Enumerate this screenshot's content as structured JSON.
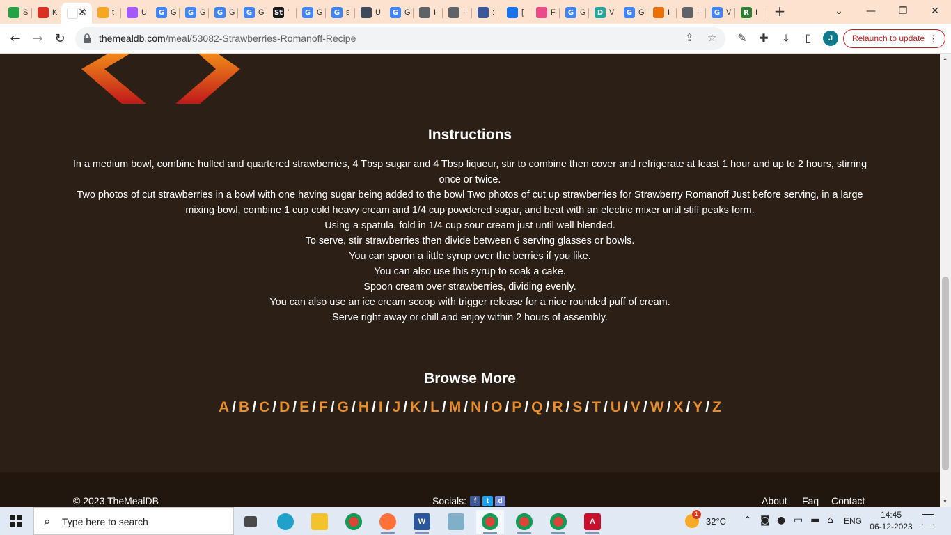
{
  "browser": {
    "tabs": [
      {
        "title": "S",
        "color": "#25a244",
        "glyph": ""
      },
      {
        "title": "K",
        "color": "#d93025",
        "glyph": ""
      },
      {
        "title": "S",
        "color": "#ffffff",
        "glyph": "",
        "active": true
      },
      {
        "title": "t",
        "color": "#f5a623",
        "glyph": ""
      },
      {
        "title": "U",
        "color": "#a259ff",
        "glyph": ""
      },
      {
        "title": "G",
        "color": "#4285f4",
        "glyph": "G"
      },
      {
        "title": "G",
        "color": "#4285f4",
        "glyph": "G"
      },
      {
        "title": "G",
        "color": "#4285f4",
        "glyph": "G"
      },
      {
        "title": "G",
        "color": "#4285f4",
        "glyph": "G"
      },
      {
        "title": "'",
        "color": "#1a1a1a",
        "glyph": "St"
      },
      {
        "title": "G",
        "color": "#4285f4",
        "glyph": "G"
      },
      {
        "title": "s",
        "color": "#4285f4",
        "glyph": "G"
      },
      {
        "title": "U",
        "color": "#3c4a5c",
        "glyph": ""
      },
      {
        "title": "G",
        "color": "#4285f4",
        "glyph": "G"
      },
      {
        "title": "I",
        "color": "#5f6368",
        "glyph": ""
      },
      {
        "title": "I",
        "color": "#5f6368",
        "glyph": ""
      },
      {
        "title": ":",
        "color": "#3b5998",
        "glyph": ""
      },
      {
        "title": "[",
        "color": "#1a73e8",
        "glyph": ""
      },
      {
        "title": "F",
        "color": "#ea4c89",
        "glyph": ""
      },
      {
        "title": "G",
        "color": "#4285f4",
        "glyph": "G"
      },
      {
        "title": "V",
        "color": "#26a69a",
        "glyph": "D"
      },
      {
        "title": "G",
        "color": "#4285f4",
        "glyph": "G"
      },
      {
        "title": "I",
        "color": "#e8710a",
        "glyph": ""
      },
      {
        "title": "I",
        "color": "#5f6368",
        "glyph": ""
      },
      {
        "title": "V",
        "color": "#4285f4",
        "glyph": "G"
      },
      {
        "title": "I",
        "color": "#2e7d32",
        "glyph": "R"
      }
    ],
    "tab_close": "✕",
    "new_tab": "+",
    "url_host": "themealdb.com",
    "url_path": "/meal/53082-Strawberries-Romanoff-Recipe",
    "relaunch_label": "Relaunch to update",
    "profile_initial": "J"
  },
  "page": {
    "instructions_title": "Instructions",
    "instructions": [
      "In a medium bowl, combine hulled and quartered strawberries, 4 Tbsp sugar and 4 Tbsp liqueur, stir to combine then cover and refrigerate at least 1 hour and up to 2 hours, stirring once or twice.",
      "Two photos of cut strawberries in a bowl with one having sugar being added to the bowl Two photos of cut up strawberries for Strawberry Romanoff Just before serving, in a large mixing bowl, combine 1 cup cold heavy cream and 1/4 cup powdered sugar, and beat with an electric mixer until stiff peaks form.",
      "Using a spatula, fold in 1/4 cup sour cream just until well blended.",
      "To serve, stir strawberries then divide between 6 serving glasses or bowls.",
      "You can spoon a little syrup over the berries if you like.",
      "You can also use this syrup to soak a cake.",
      "Spoon cream over strawberries, dividing evenly.",
      "You can also use an ice cream scoop with trigger release for a nice rounded puff of cream.",
      "Serve right away or chill and enjoy within 2 hours of assembly."
    ],
    "browse_title": "Browse More",
    "letters": [
      "A",
      "B",
      "C",
      "D",
      "E",
      "F",
      "G",
      "H",
      "I",
      "J",
      "K",
      "L",
      "M",
      "N",
      "O",
      "P",
      "Q",
      "R",
      "S",
      "T",
      "U",
      "V",
      "W",
      "X",
      "Y",
      "Z"
    ],
    "letter_separator": "/",
    "accent_color": "#e98f30",
    "background_color": "#2b1f16"
  },
  "footer": {
    "copyright": "© 2023 TheMealDB",
    "socials_label": "Socials:",
    "links": [
      "About",
      "Faq",
      "Contact"
    ]
  },
  "taskbar": {
    "search_placeholder": "Type here to search",
    "weather_temp": "32°C",
    "weather_badge": "1",
    "language": "ENG",
    "time": "14:45",
    "date": "06-12-2023"
  }
}
